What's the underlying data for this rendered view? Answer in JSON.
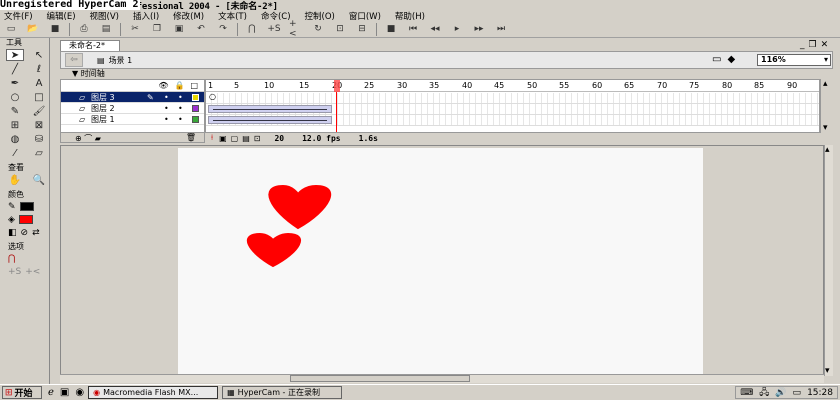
{
  "watermark": "Unregistered HyperCam 2",
  "window_title": "Unregistered HyperCam 2professional 2004 - [未命名-2*]",
  "menu": [
    "文件(F)",
    "编辑(E)",
    "视图(V)",
    "插入(I)",
    "修改(M)",
    "文本(T)",
    "命令(C)",
    "控制(O)",
    "窗口(W)",
    "帮助(H)"
  ],
  "tools": {
    "header": "工具",
    "view_header": "查看",
    "colors_header": "颜色",
    "options_header": "选项"
  },
  "document": {
    "tab": "未命名-2*",
    "scene": "场景 1",
    "zoom": "116%"
  },
  "timeline": {
    "header": "时间轴",
    "ruler": [
      "1",
      "5",
      "10",
      "15",
      "20",
      "25",
      "30",
      "35",
      "40",
      "45",
      "50",
      "55",
      "60",
      "65",
      "70",
      "75",
      "80",
      "85",
      "90"
    ],
    "layers": [
      {
        "name": "图层 3",
        "color": "#e8d800",
        "selected": true
      },
      {
        "name": "图层 2",
        "color": "#9b2fd0",
        "selected": false
      },
      {
        "name": "图层 1",
        "color": "#3aa83a",
        "selected": false
      }
    ],
    "current_frame": "20",
    "fps": "12.0 fps",
    "time": "1.6s"
  },
  "stage": {
    "shape_color": "#ff0000"
  },
  "taskbar": {
    "start": "开始",
    "tasks": [
      "Macromedia Flash MX...",
      "HyperCam - 正在录制"
    ],
    "clock": "15:28"
  }
}
